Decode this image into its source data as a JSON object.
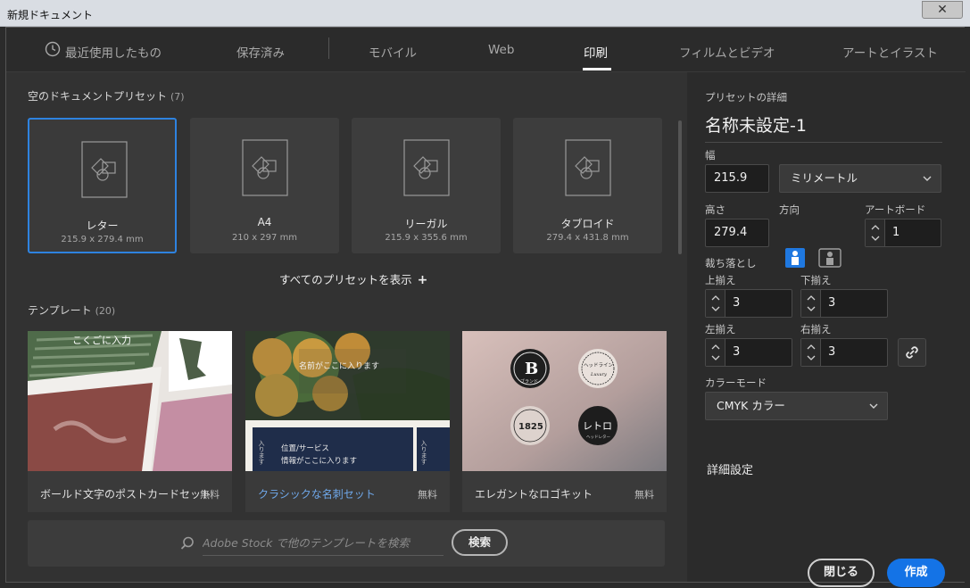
{
  "window": {
    "title": "新規ドキュメント",
    "close_label": "✕"
  },
  "tabs": [
    {
      "label": "最近使用したもの"
    },
    {
      "label": "保存済み"
    },
    {
      "label": "モバイル"
    },
    {
      "label": "Web"
    },
    {
      "label": "印刷",
      "active": true
    },
    {
      "label": "フィルムとビデオ"
    },
    {
      "label": "アートとイラスト"
    }
  ],
  "presets": {
    "title": "空のドキュメントプリセット",
    "count": "(7)",
    "items": [
      {
        "name": "レター",
        "size": "215.9 x 279.4 mm",
        "selected": true
      },
      {
        "name": "A4",
        "size": "210 x 297 mm"
      },
      {
        "name": "リーガル",
        "size": "215.9 x 355.6 mm"
      },
      {
        "name": "タブロイド",
        "size": "279.4 x 431.8 mm"
      }
    ],
    "show_all": "すべてのプリセットを表示",
    "show_all_icon": "+"
  },
  "templates": {
    "title": "テンプレート",
    "count": "(20)",
    "items": [
      {
        "name": "ボールド文字のポストカードセット",
        "price": "無料"
      },
      {
        "name": "クラシックな名刺セット",
        "price": "無料",
        "highlight": true
      },
      {
        "name": "エレガントなロゴキット",
        "price": "無料"
      }
    ],
    "thumb_text": {
      "t1_top": "こくごに入力",
      "t2_name": "名前がここに入ります",
      "t2_line1": "位置/サービス",
      "t2_line2": "情報がここに入ります",
      "t2_side": "入ります",
      "t3_b": "B",
      "t3_b_sub": "ブランド",
      "t3_headline": "ヘッドライン",
      "t3_luxury": "Luxury",
      "t3_year": "1825",
      "t3_retro": "レトロ",
      "t3_retro_sub": "ヘッドレター"
    }
  },
  "stock": {
    "placeholder": "Adobe Stock で他のテンプレートを検索",
    "search_label": "検索"
  },
  "details": {
    "header": "プリセットの詳細",
    "doc_name": "名称未設定-1",
    "width_label": "幅",
    "width_value": "215.9",
    "unit": "ミリメートル",
    "height_label": "高さ",
    "height_value": "279.4",
    "orientation_label": "方向",
    "artboard_label": "アートボード",
    "artboard_value": "1",
    "bleed_label": "裁ち落とし",
    "bleed_top_label": "上揃え",
    "bleed_top": "3",
    "bleed_bottom_label": "下揃え",
    "bleed_bottom": "3",
    "bleed_left_label": "左揃え",
    "bleed_left": "3",
    "bleed_right_label": "右揃え",
    "bleed_right": "3",
    "color_mode_label": "カラーモード",
    "color_mode": "CMYK カラー",
    "advanced": "詳細設定",
    "close_label": "閉じる",
    "create_label": "作成"
  },
  "colors": {
    "accent": "#1473e6",
    "selected_border": "#2e83e0",
    "link": "#6fa8ea"
  }
}
